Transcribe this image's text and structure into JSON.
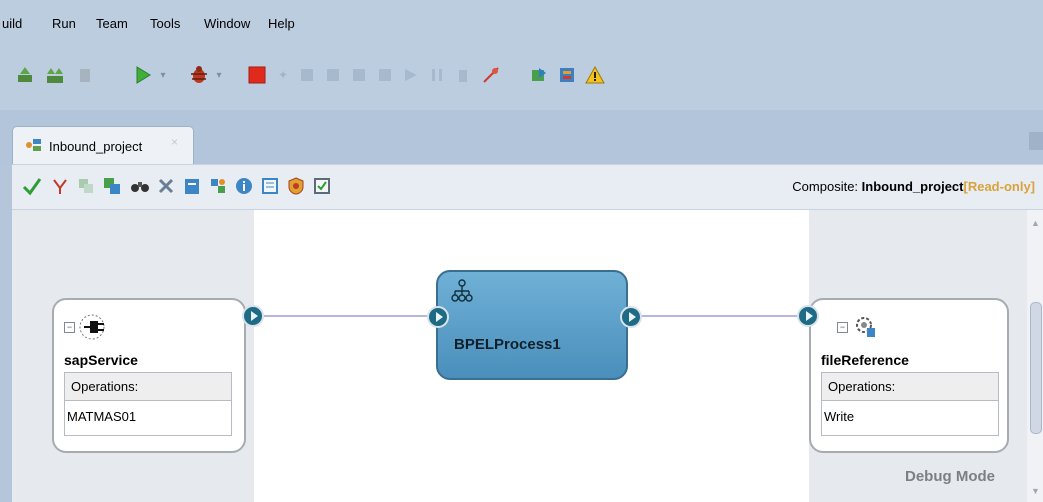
{
  "menu": {
    "items": [
      "uild",
      "Run",
      "Team",
      "Tools",
      "Window",
      "Help"
    ]
  },
  "toolbar": {
    "icons": [
      "deploy-icon",
      "deploy-all-icon",
      "stop-deploy-icon",
      "run-icon",
      "debug-icon",
      "stop-icon",
      "step-icon",
      "warning-icon"
    ]
  },
  "tab": {
    "label": "Inbound_project",
    "close": "×"
  },
  "editor": {
    "composite_prefix": "Composite: ",
    "composite_name": "Inbound_project",
    "composite_status": "[Read-only]"
  },
  "components": {
    "service": {
      "title": "sapService",
      "ops_header": "Operations:",
      "op": "MATMAS01"
    },
    "bpel": {
      "title": "BPELProcess1"
    },
    "reference": {
      "title": "fileReference",
      "ops_header": "Operations:",
      "op": "Write"
    }
  },
  "canvas": {
    "mode": "Debug Mode"
  },
  "colors": {
    "accent": "#1f6b86",
    "read_only": "#d9a23a",
    "bpel_fill": "#5d9fc9"
  }
}
